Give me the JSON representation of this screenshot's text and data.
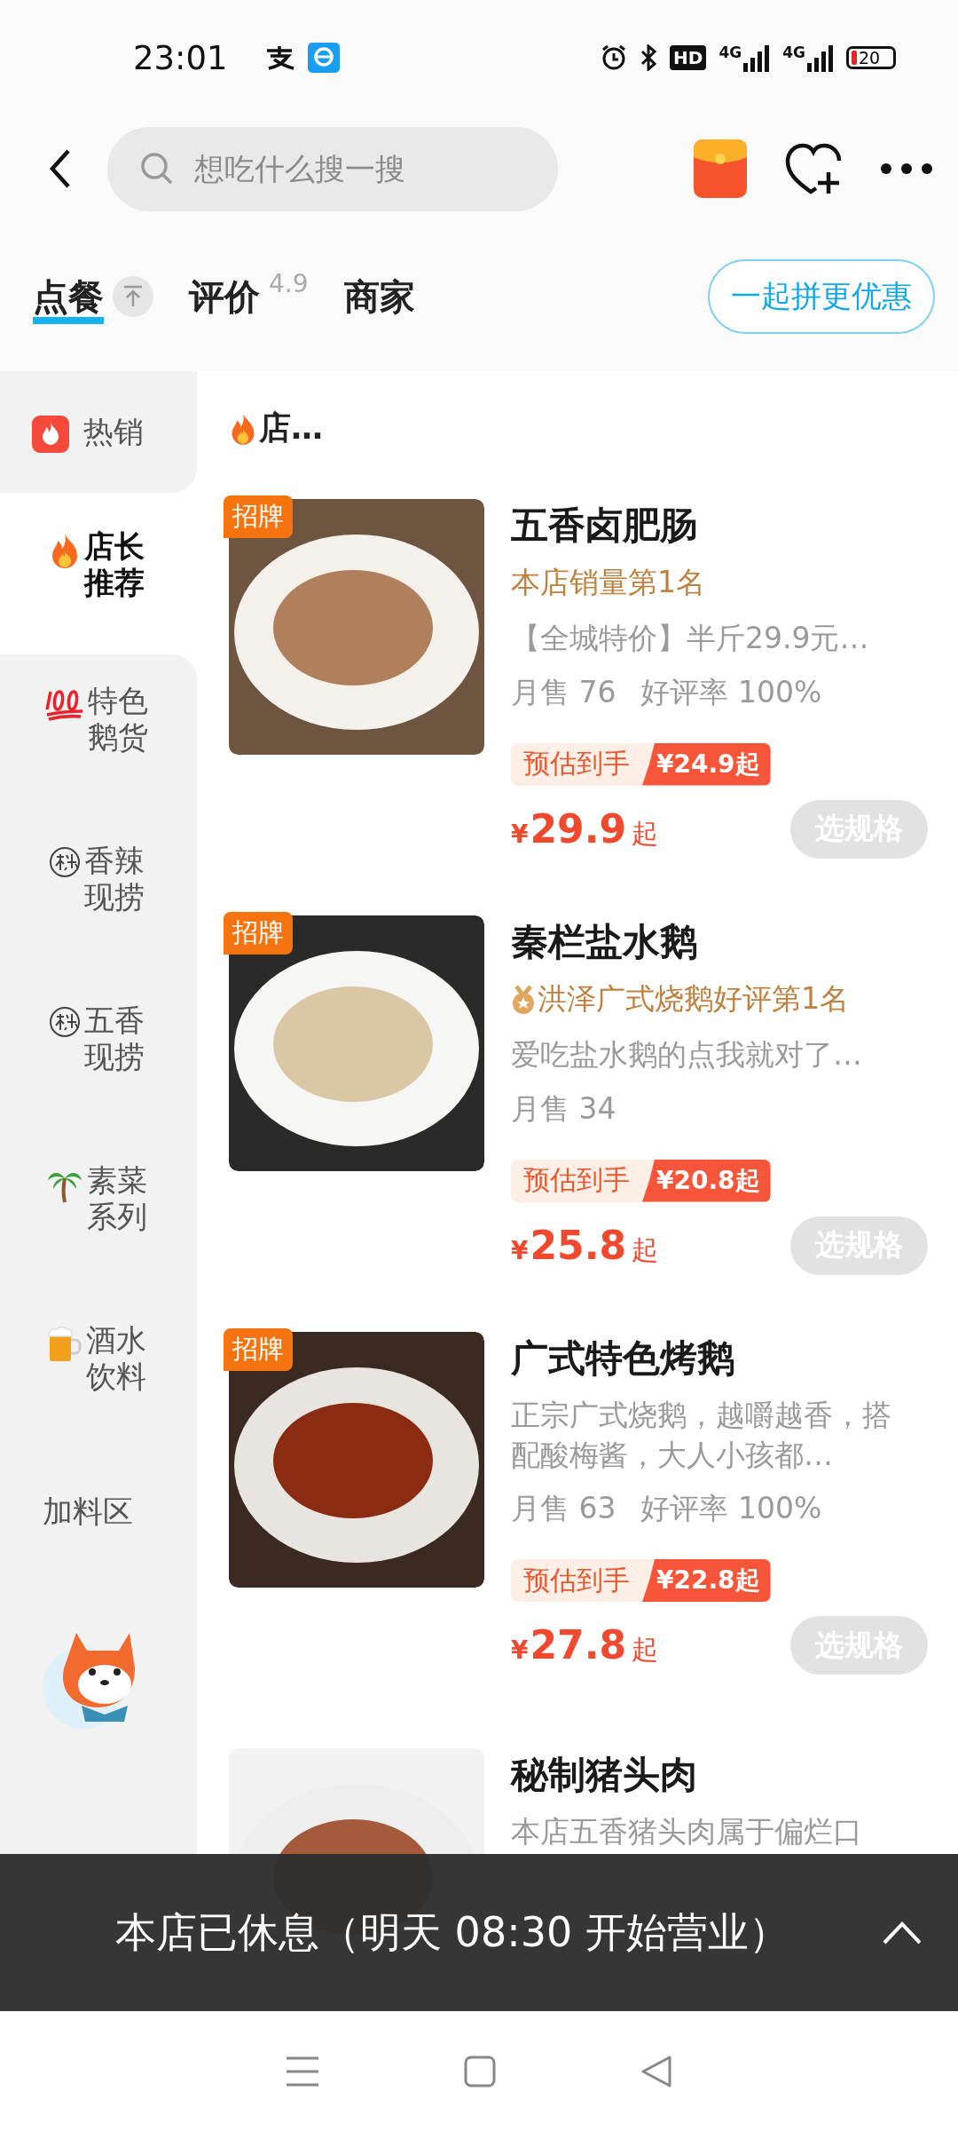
{
  "status_bar": {
    "time": "23:01",
    "hd_label": "HD",
    "network_1": "4G",
    "network_2": "4G",
    "battery": "20"
  },
  "header": {
    "search": {
      "placeholder": "想吃什么搜一搜"
    }
  },
  "tabs": [
    {
      "label": "点餐",
      "selected": true,
      "pin": true
    },
    {
      "label": "评价",
      "selected": false,
      "rating": "4.9"
    },
    {
      "label": "商家",
      "selected": false
    }
  ],
  "group_button": "一起拼更优惠",
  "sidebar": {
    "items": [
      {
        "label": "热销",
        "kind": "hot",
        "selected": false
      },
      {
        "label": "店长推荐",
        "kind": "fire",
        "selected": true
      },
      {
        "label": "特色鹅货",
        "kind": "hundred",
        "selected": false
      },
      {
        "label": "香辣现捞",
        "kind": "secret",
        "selected": false
      },
      {
        "label": "五香现捞",
        "kind": "secret",
        "selected": false
      },
      {
        "label": "素菜系列",
        "kind": "palm",
        "selected": false
      },
      {
        "label": "酒水饮料",
        "kind": "beer",
        "selected": false
      },
      {
        "label": "加料区",
        "kind": "plain",
        "selected": false
      }
    ]
  },
  "section_title": "店…",
  "dishes": [
    {
      "badge": "招牌",
      "name": "五香卤肥肠",
      "rank": {
        "text": "本店销量第1名",
        "medal": false
      },
      "desc": "【全城特价】半斤29.9元…",
      "sales": "月售 76",
      "rating": "好评率 100%",
      "promo_label": "预估到手",
      "promo_price": "¥24.9起",
      "price_symbol": "¥",
      "price": "29.9",
      "price_suffix": "起",
      "spec_button": {
        "label": "选规格",
        "disabled": true
      }
    },
    {
      "badge": "招牌",
      "name": "秦栏盐水鹅",
      "rank": {
        "text": "洪泽广式烧鹅好评第1名",
        "medal": true
      },
      "desc": "爱吃盐水鹅的点我就对了…",
      "sales": "月售 34",
      "promo_label": "预估到手",
      "promo_price": "¥20.8起",
      "price_symbol": "¥",
      "price": "25.8",
      "price_suffix": "起",
      "spec_button": {
        "label": "选规格",
        "disabled": true
      }
    },
    {
      "badge": "招牌",
      "name": "广式特色烤鹅",
      "desc": "正宗广式烧鹅，越嚼越香，搭配酸梅酱，大人小孩都…",
      "sales": "月售 63",
      "rating": "好评率 100%",
      "promo_label": "预估到手",
      "promo_price": "¥22.8起",
      "price_symbol": "¥",
      "price": "27.8",
      "price_suffix": "起",
      "spec_button": {
        "label": "选规格",
        "disabled": true
      }
    },
    {
      "name": "秘制猪头肉",
      "desc": "本店五香猪头肉属于偏烂口"
    }
  ],
  "closed_notice": {
    "text": "本店已休息（明天 08:30 开始营业）"
  }
}
